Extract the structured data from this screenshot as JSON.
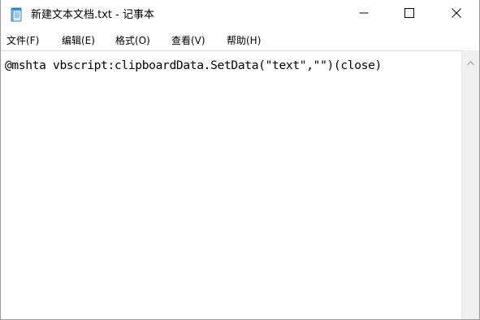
{
  "window": {
    "title": "新建文本文档.txt - 记事本",
    "icons": {
      "app": "notepad-icon",
      "minimize": "minimize-icon",
      "maximize": "maximize-icon",
      "close": "close-icon"
    }
  },
  "menubar": {
    "items": [
      {
        "label": "文件(F)"
      },
      {
        "label": "编辑(E)"
      },
      {
        "label": "格式(O)"
      },
      {
        "label": "查看(V)"
      },
      {
        "label": "帮助(H)"
      }
    ]
  },
  "editor": {
    "content": "@mshta vbscript:clipboardData.SetData(\"text\",\"\")(close)"
  },
  "scrollbar": {
    "up_icon": "chevron-up-icon"
  },
  "colors": {
    "background": "#ffffff",
    "scrollbar_track": "#f0f0f0",
    "text": "#000000"
  }
}
